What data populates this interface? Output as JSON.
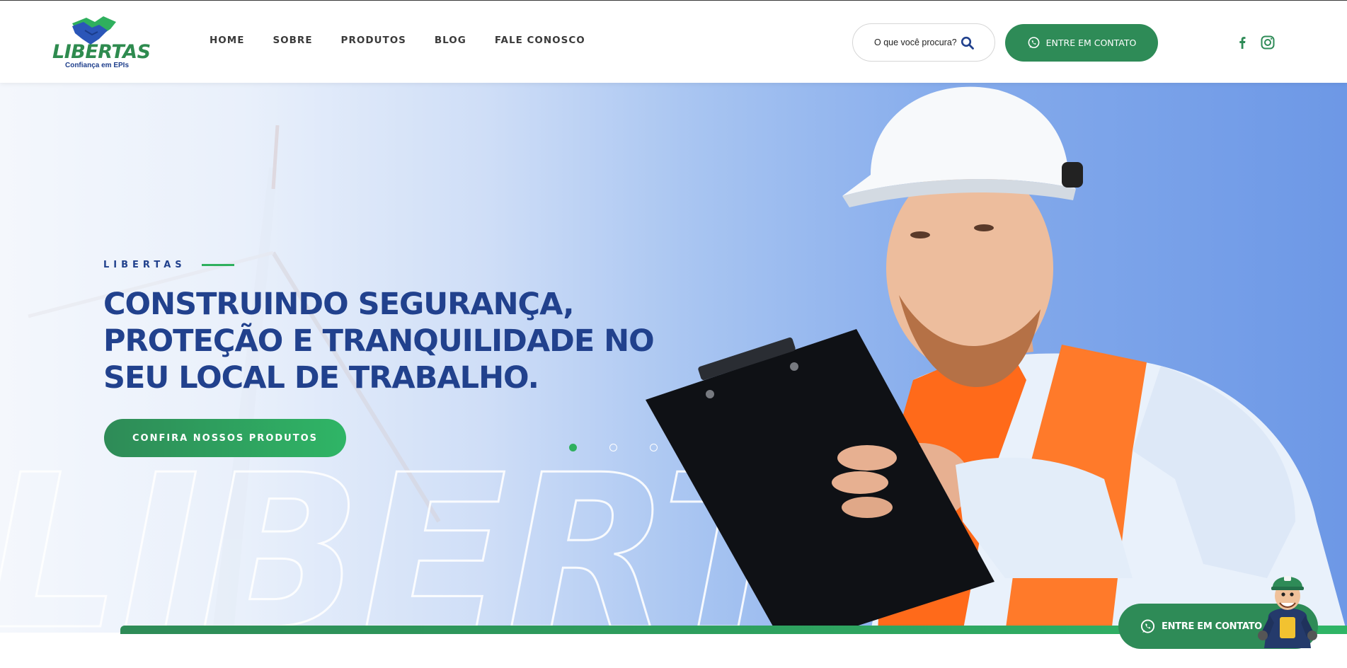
{
  "brand": {
    "name": "LIBERTAS",
    "tagline": "Confiança em EPIs"
  },
  "nav": {
    "items": [
      "HOME",
      "SOBRE",
      "PRODUTOS",
      "BLOG",
      "FALE CONOSCO"
    ]
  },
  "search": {
    "placeholder": "O que você procura?"
  },
  "header_cta": {
    "label": "ENTRE EM CONTATO"
  },
  "social": {
    "icons": [
      "facebook-icon",
      "instagram-icon"
    ]
  },
  "hero": {
    "eyebrow": "LIBERTAS",
    "headline": "CONSTRUINDO SEGURANÇA, PROTEÇÃO E TRANQUILIDADE NO SEU LOCAL DE TRABALHO.",
    "button": "CONFIRA NOSSOS PRODUTOS",
    "watermark": "LIBERTAS",
    "slider": {
      "count": 3,
      "active": 1
    }
  },
  "floating_cta": {
    "label": "ENTRE EM CONTATO"
  },
  "colors": {
    "brand_green": "#2e8b57",
    "brand_blue": "#21418d",
    "accent_green": "#2fb05e",
    "hero_vest_orange": "#ff6a1a"
  }
}
